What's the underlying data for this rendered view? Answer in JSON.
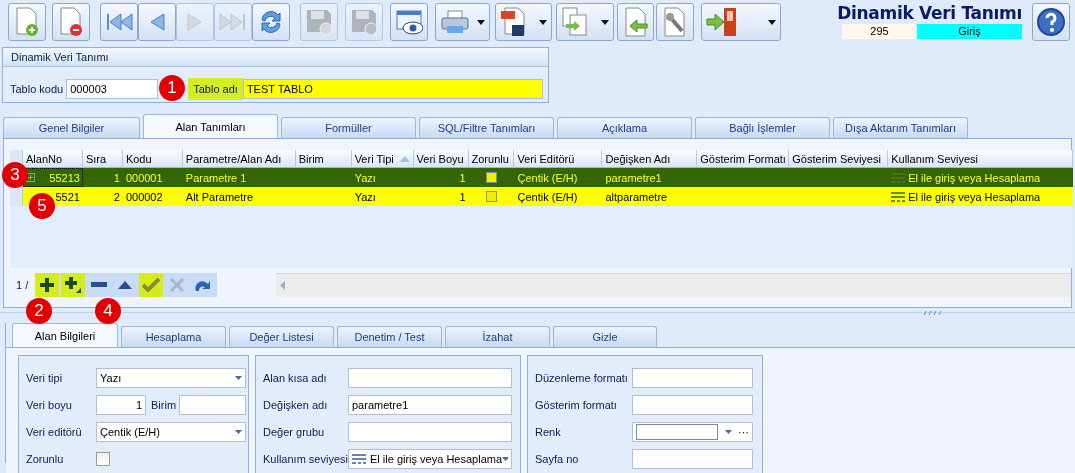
{
  "toolbar": [
    {
      "disabled": false,
      "menu": false
    },
    {
      "disabled": false,
      "menu": false
    },
    {
      "disabled": false,
      "menu": false
    },
    {
      "disabled": false,
      "menu": false
    },
    {
      "disabled": true,
      "menu": false
    },
    {
      "disabled": true,
      "menu": false
    },
    {
      "disabled": false,
      "menu": false
    },
    {
      "disabled": true,
      "menu": false
    },
    {
      "disabled": true,
      "menu": false
    },
    {
      "disabled": false,
      "menu": false
    },
    {
      "disabled": false,
      "menu": true
    },
    {
      "disabled": false,
      "menu": true
    },
    {
      "disabled": false,
      "menu": true
    },
    {
      "disabled": false,
      "menu": false
    },
    {
      "disabled": false,
      "menu": false
    },
    {
      "disabled": false,
      "menu": true
    }
  ],
  "header": {
    "title": "Dinamik Veri Tanımı",
    "record": "295",
    "mode": "Giriş"
  },
  "panel": {
    "title": "Dinamik Veri Tanımı",
    "code_label": "Tablo kodu",
    "code_value": "000003",
    "name_label": "Tablo adı",
    "name_value": "TEST TABLO"
  },
  "tabs": [
    {
      "label": "Genel Bilgiler",
      "selected": false
    },
    {
      "label": "Alan Tanımları",
      "selected": true
    },
    {
      "label": "Formüller",
      "selected": false
    },
    {
      "label": "SQL/Filtre Tanımları",
      "selected": false
    },
    {
      "label": "Açıklama",
      "selected": false
    },
    {
      "label": "Bağlı İşlemler",
      "selected": false
    },
    {
      "label": "Dışa Aktarım Tanımları",
      "selected": false
    }
  ],
  "table": {
    "columns": [
      {
        "label": "AlanNo",
        "sorted": false
      },
      {
        "label": "Sıra",
        "sorted": false
      },
      {
        "label": "Kodu",
        "sorted": false
      },
      {
        "label": "Parametre/Alan Adı",
        "sorted": false
      },
      {
        "label": "Birim",
        "sorted": false
      },
      {
        "label": "Veri Tipi",
        "sorted": true
      },
      {
        "label": "Veri Boyu",
        "sorted": false
      },
      {
        "label": "Zorunlu",
        "sorted": false
      },
      {
        "label": "Veri Editörü",
        "sorted": false
      },
      {
        "label": "Değişken Adı",
        "sorted": false
      },
      {
        "label": "Gösterim Formatı",
        "sorted": false
      },
      {
        "label": "Gösterim Seviyesi",
        "sorted": false
      },
      {
        "label": "Kullanım Seviyesi",
        "sorted": false
      }
    ],
    "rows": [
      {
        "selected": true,
        "alan_no": "55213",
        "sira": "1",
        "kodu": "000001",
        "parametre": "Parametre 1",
        "veri_tipi": "Yazı",
        "veri_boyu": "1",
        "zorunlu": false,
        "veri_editoru": "Çentik (E/H)",
        "degisken_adi": "parametre1",
        "kullanim_seviyesi": "El ile giriş veya Hesaplama"
      },
      {
        "selected": false,
        "alan_no": "5521",
        "sira": "2",
        "kodu": "000002",
        "parametre": "Alt Parametre",
        "veri_tipi": "Yazı",
        "veri_boyu": "1",
        "zorunlu": false,
        "veri_editoru": "Çentik (E/H)",
        "degisken_adi": "altparametre",
        "kullanim_seviyesi": "El ile giriş veya Hesaplama"
      }
    ]
  },
  "navigator": {
    "position": "1 /",
    "buttons": [
      {
        "highlighted": true,
        "disabled": false
      },
      {
        "highlighted": true,
        "disabled": false
      },
      {
        "highlighted": false,
        "disabled": false
      },
      {
        "highlighted": false,
        "disabled": false
      },
      {
        "highlighted": true,
        "disabled": false
      },
      {
        "highlighted": false,
        "disabled": true
      },
      {
        "highlighted": false,
        "disabled": false
      }
    ]
  },
  "detail_tabs": [
    {
      "label": "Alan Bilgileri",
      "selected": true
    },
    {
      "label": "Hesaplama",
      "selected": false
    },
    {
      "label": "Değer Listesi",
      "selected": false
    },
    {
      "label": "Denetim / Test",
      "selected": false
    },
    {
      "label": "İzahat",
      "selected": false
    },
    {
      "label": "Gizle",
      "selected": false
    }
  ],
  "groups": [
    {
      "fields": [
        {
          "kind": "dropdown",
          "label": "Veri tipi",
          "value": "Yazı"
        },
        {
          "kind": "split",
          "label": "Veri boyu",
          "value": "1",
          "label2": "Birim"
        },
        {
          "kind": "dropdown",
          "label": "Veri editörü",
          "value": "Çentik (E/H)"
        },
        {
          "kind": "checkbox",
          "label": "Zorunlu",
          "checked": false
        }
      ]
    },
    {
      "fields": [
        {
          "kind": "text",
          "label": "Alan kısa adı"
        },
        {
          "kind": "text",
          "label": "Değişken adı",
          "value": "parametre1"
        },
        {
          "kind": "text",
          "label": "Değer grubu"
        },
        {
          "kind": "icondropdown",
          "label": "Kullanım seviyesi",
          "value": "El ile giriş veya Hesaplama"
        }
      ]
    },
    {
      "fields": [
        {
          "kind": "text",
          "label": "Düzenleme formatı"
        },
        {
          "kind": "text",
          "label": "Gösterim formatı"
        },
        {
          "kind": "color",
          "label": "Renk",
          "value": "···"
        },
        {
          "kind": "text",
          "label": "Sayfa no"
        }
      ]
    }
  ],
  "badges": [
    {
      "text": "1"
    },
    {
      "text": "2"
    },
    {
      "text": "3"
    },
    {
      "text": "4"
    },
    {
      "text": "5"
    }
  ]
}
